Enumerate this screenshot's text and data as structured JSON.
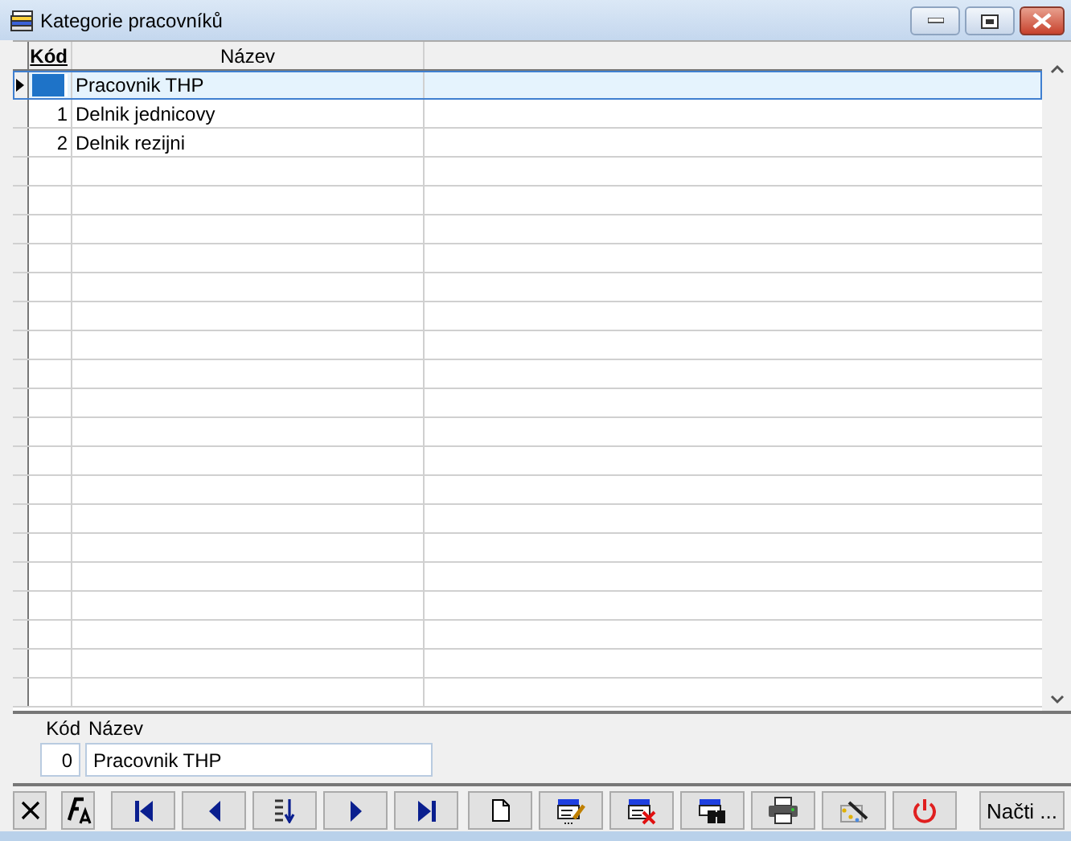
{
  "window": {
    "title": "Kategorie pracovníků"
  },
  "grid": {
    "columns": [
      "Kód",
      "Název"
    ],
    "rows": [
      {
        "name": "Pracovnik THP",
        "selected": true
      },
      {
        "code": "1",
        "name": "Delnik jednicovy",
        "selected": false
      },
      {
        "code": "2",
        "name": "Delnik rezijni",
        "selected": false
      }
    ]
  },
  "detail": {
    "labels": [
      "Kód",
      "Název"
    ],
    "code": "0",
    "name": "Pracovnik THP"
  },
  "toolbar": [
    {
      "kind": "cancel"
    },
    {
      "kind": "font"
    },
    {
      "kind": "first"
    },
    {
      "kind": "prev"
    },
    {
      "kind": "sort"
    },
    {
      "kind": "next"
    },
    {
      "kind": "last"
    },
    {
      "kind": "new"
    },
    {
      "kind": "edit"
    },
    {
      "kind": "delete"
    },
    {
      "kind": "find"
    },
    {
      "kind": "print"
    },
    {
      "kind": "wizard"
    },
    {
      "kind": "power"
    },
    {
      "kind": "text",
      "label": "Načti ..."
    }
  ]
}
